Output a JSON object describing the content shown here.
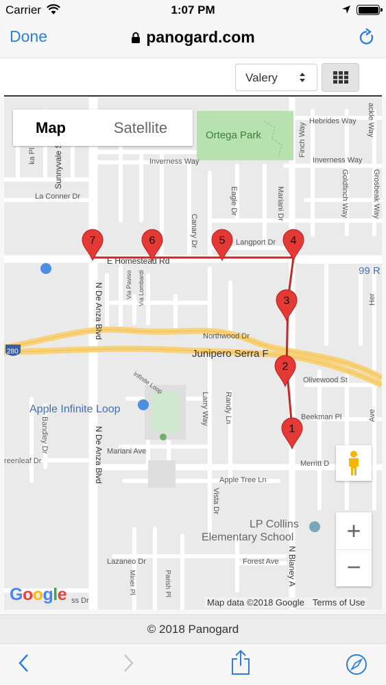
{
  "status_bar": {
    "carrier": "Carrier",
    "time": "1:07 PM"
  },
  "browser": {
    "done_label": "Done",
    "url": "panogard.com"
  },
  "toolbar": {
    "selected_user": "Valery"
  },
  "map": {
    "map_tab": "Map",
    "satellite_tab": "Satellite",
    "attribution": "Map data ©2018 Google",
    "terms": "Terms of Use",
    "google": [
      "G",
      "o",
      "o",
      "g",
      "l",
      "e"
    ],
    "google_colors": [
      "#4285f4",
      "#ea4335",
      "#fbbc05",
      "#4285f4",
      "#34a853",
      "#ea4335"
    ],
    "route_color": "#c62828",
    "marker_color": "#e53935",
    "markers": [
      "1",
      "2",
      "3",
      "4",
      "5",
      "6",
      "7"
    ],
    "labels": {
      "ortega_park": "Ortega Park",
      "hebrides": "Hebrides Way",
      "inverness_w": "Inverness Way",
      "inverness_e": "Inverness Way",
      "la_conner": "La Conner Dr",
      "langport": "Langport Dr",
      "homestead": "E Homestead Rd",
      "route99": "99 R",
      "northwood": "Northwood Dr",
      "junipero": "Junipero Serra F",
      "i280": "280",
      "olivewood": "Olivewood St",
      "beekman": "Beekman Pl",
      "apple_infinite_loop": "Apple Infinite Loop",
      "infinite_loop": "Infinite Loop",
      "mariani_ave": "Mariani Ave",
      "merritt": "Merritt D",
      "apple_tree": "Apple Tree Ln",
      "lp_collins_1": "LP Collins",
      "lp_collins_2": "Elementary School",
      "forest_ave": "Forest Ave",
      "lazaneo": "Lazaneo Dr",
      "greenleaf": "reenleaf Dr",
      "n_de_anza_1": "N De Anza Blvd",
      "n_de_anza_2": "N De Anza Blvd",
      "sunnyvale": "Sunnyvale Sarat",
      "n_blaney": "N Blaney A",
      "n_bla_upper": "N Bla",
      "eagle": "Eagle Dr",
      "canary": "Canary Dr",
      "mariani_dr": "Mariani Dr",
      "finch": "Finch Way",
      "goldfinch": "Goldfinch Way",
      "grosbeak": "Grosbeak Way",
      "hackle": "ackle Way",
      "larry": "Larry Way",
      "randy": "Randy Ln",
      "vista": "Vista Dr",
      "bandley": "Bandley Dr",
      "via_paviso": "Via Paviso",
      "via_lombardi": "Via Lombardi",
      "miner": "Miner Pl",
      "parish": "Parish Pl",
      "ka_pl": "ka Pl",
      "ss_dr": "ss Dr",
      "alameda": "Ave",
      "here": "Her"
    }
  },
  "footer": {
    "copyright": "© 2018 Panogard"
  }
}
